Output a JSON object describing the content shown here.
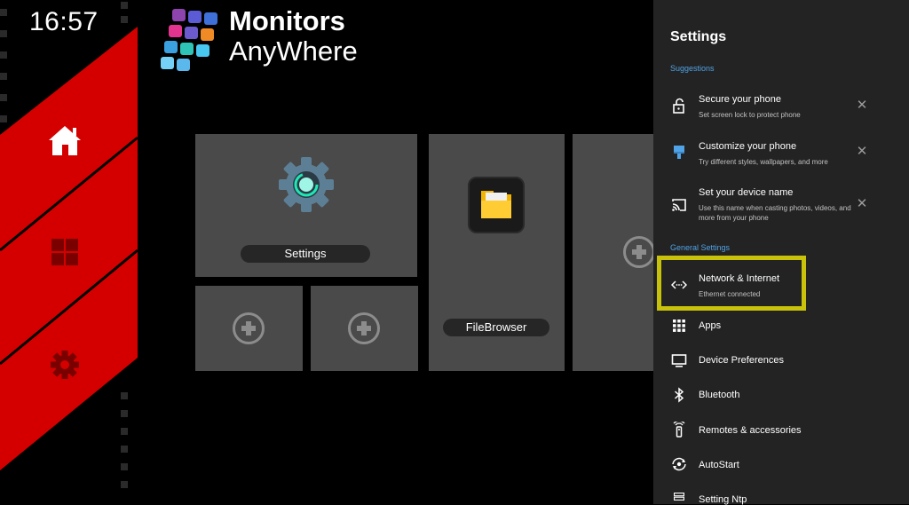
{
  "clock": "16:57",
  "brand": {
    "name_line1": "Monitors",
    "name_line2": "AnyWhere"
  },
  "nav": [
    {
      "icon": "home-icon"
    },
    {
      "icon": "windows-icon"
    },
    {
      "icon": "gear-icon"
    }
  ],
  "tiles": {
    "settings": {
      "label": "Settings"
    },
    "filebrowser": {
      "label": "FileBrowser"
    }
  },
  "settings_panel": {
    "title": "Settings",
    "suggestions_header": "Suggestions",
    "suggestions": [
      {
        "title": "Secure your phone",
        "subtitle": "Set screen lock to protect phone",
        "icon": "lock-icon"
      },
      {
        "title": "Customize your phone",
        "subtitle": "Try different styles, wallpapers, and more",
        "icon": "brush-icon"
      },
      {
        "title": "Set your device name",
        "subtitle": "Use this name when casting photos, videos, and more from your phone",
        "icon": "cast-icon"
      }
    ],
    "general_header": "General Settings",
    "general": [
      {
        "title": "Network & Internet",
        "subtitle": "Ethernet connected",
        "icon": "network-icon"
      },
      {
        "title": "Apps",
        "icon": "apps-grid-icon"
      },
      {
        "title": "Device Preferences",
        "icon": "monitor-icon"
      },
      {
        "title": "Bluetooth",
        "icon": "bluetooth-icon"
      },
      {
        "title": "Remotes & accessories",
        "icon": "remote-icon"
      },
      {
        "title": "AutoStart",
        "icon": "autostart-icon"
      },
      {
        "title": "Setting Ntp",
        "icon": "server-icon"
      }
    ]
  },
  "colors": {
    "accent_red": "#d40000",
    "highlight": "#c8c20a",
    "link_blue": "#4fa3e6",
    "tile_gray": "#4a4a4a"
  }
}
